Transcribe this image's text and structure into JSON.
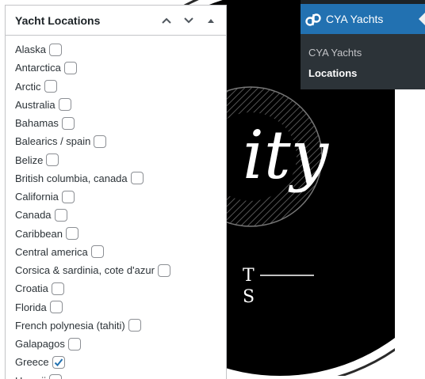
{
  "metabox": {
    "title": "Yacht Locations",
    "locations": [
      {
        "label": "Alaska",
        "checked": false
      },
      {
        "label": "Antarctica",
        "checked": false
      },
      {
        "label": "Arctic",
        "checked": false
      },
      {
        "label": "Australia",
        "checked": false
      },
      {
        "label": "Bahamas",
        "checked": false
      },
      {
        "label": "Balearics / spain",
        "checked": false
      },
      {
        "label": "Belize",
        "checked": false
      },
      {
        "label": "British columbia, canada",
        "checked": false
      },
      {
        "label": "California",
        "checked": false
      },
      {
        "label": "Canada",
        "checked": false
      },
      {
        "label": "Caribbean",
        "checked": false
      },
      {
        "label": "Central america",
        "checked": false
      },
      {
        "label": "Corsica & sardinia, cote d'azur",
        "checked": false
      },
      {
        "label": "Croatia",
        "checked": false
      },
      {
        "label": "Florida",
        "checked": false
      },
      {
        "label": "French polynesia (tahiti)",
        "checked": false
      },
      {
        "label": "Galapagos",
        "checked": false
      },
      {
        "label": "Greece",
        "checked": true
      },
      {
        "label": "Hawaii",
        "checked": false
      }
    ]
  },
  "admin_menu": {
    "title": "CYA Yachts",
    "items": [
      {
        "label": "CYA Yachts",
        "current": false
      },
      {
        "label": "Locations",
        "current": true
      }
    ]
  },
  "background_logo": {
    "script_text": "ity",
    "caption_text": "T",
    "caption_text_2": "S"
  },
  "colors": {
    "accent": "#2271b1",
    "menu_bg": "#2c3338",
    "check": "#2271b1"
  }
}
